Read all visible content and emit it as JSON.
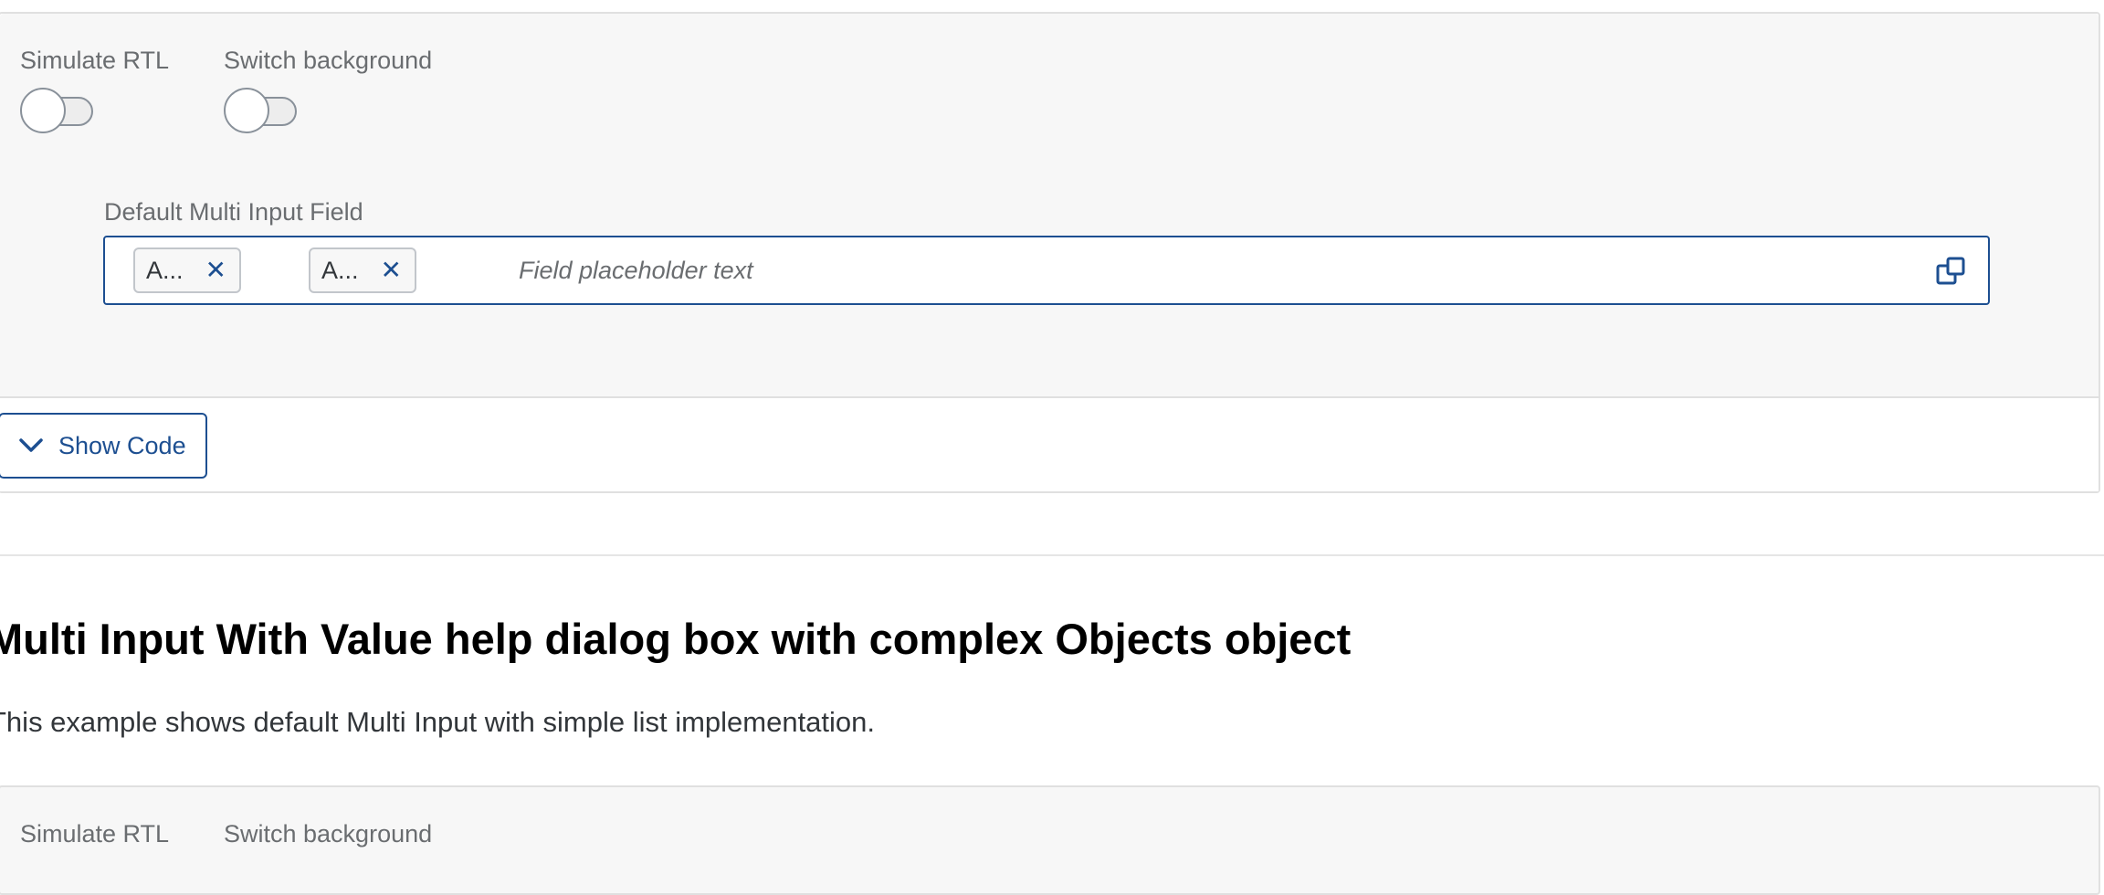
{
  "example1": {
    "toggles": {
      "rtl_label": "Simulate RTL",
      "background_label": "Switch background"
    },
    "field": {
      "label": "Default Multi Input Field",
      "tokens": [
        "A...",
        "A..."
      ],
      "placeholder": "Field placeholder text",
      "value_help_icon": "value-help-icon"
    },
    "show_code_label": "Show Code"
  },
  "section": {
    "title": "Multi Input With Value help dialog box with complex Objects object",
    "description": "This example shows default Multi Input with simple list implementation."
  },
  "example2": {
    "toggles": {
      "rtl_label": "Simulate RTL",
      "background_label": "Switch background"
    }
  },
  "colors": {
    "accent": "#1d4f91",
    "card_background": "#f7f7f7",
    "border": "#e0e0e0",
    "label_text": "#6a6d70",
    "heading_text": "#000000"
  }
}
